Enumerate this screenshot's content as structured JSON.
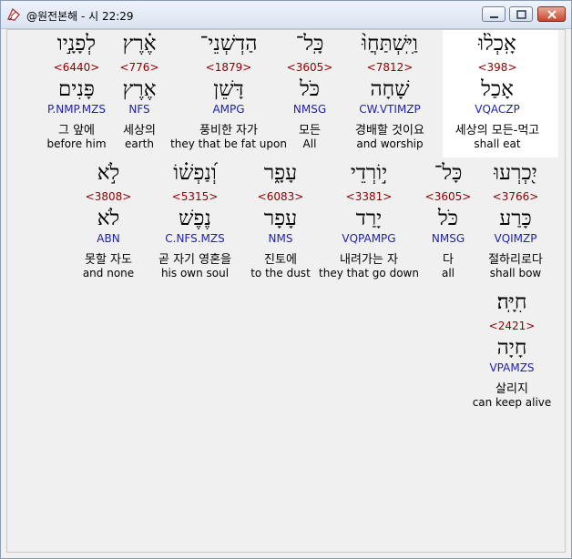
{
  "window": {
    "title": "@원전본해 - 시 22:29"
  },
  "colors": {
    "strongs": "#8b0000",
    "parsing": "#1f1fa8",
    "highlight": "#ffffff"
  },
  "words": [
    {
      "hebrew": "אָֽכְל֨וּ",
      "strongs": "<398>",
      "lemma": "אָכַל",
      "parsing": "VQACZP",
      "korean": "세상의 모든-먹고",
      "english": "shall eat"
    },
    {
      "hebrew": "וַיִּֽשְׁתַּחֲוּ֨",
      "strongs": "<7812>",
      "lemma": "שָׁחָה",
      "parsing": "CW.VTIMZP",
      "korean": "경배할 것이요",
      "english": "and worship"
    },
    {
      "hebrew": "כָּֽל־",
      "strongs": "<3605>",
      "lemma": "כֹּל",
      "parsing": "NMSG",
      "korean": "모든",
      "english": "All"
    },
    {
      "hebrew": "הַדְשְׁנֵי־",
      "strongs": "<1879>",
      "lemma": "דָּשֵׁן",
      "parsing": "AMPG",
      "korean": "풍비한 자가",
      "english": "they that be fat upon"
    },
    {
      "hebrew": "אֶ֗רֶץ",
      "strongs": "<776>",
      "lemma": "אֶרֶץ",
      "parsing": "NFS",
      "korean": "세상의",
      "english": "earth"
    },
    {
      "hebrew": "לְפָנָ֣יו",
      "strongs": "<6440>",
      "lemma": "פָּנִים",
      "parsing": "P.NMP.MZS",
      "korean": "그 앞에",
      "english": "before him"
    },
    {
      "hebrew": "יִ֭כְרְעוּ",
      "strongs": "<3766>",
      "lemma": "כָּרַע",
      "parsing": "VQIMZP",
      "korean": "절하리로다",
      "english": "shall bow"
    },
    {
      "hebrew": "כָּל־",
      "strongs": "<3605>",
      "lemma": "כֹּל",
      "parsing": "NMSG",
      "korean": "다",
      "english": "all"
    },
    {
      "hebrew": "י֣וֹרְדֵי",
      "strongs": "<3381>",
      "lemma": "יָרַד",
      "parsing": "VQPAMPG",
      "korean": "내려가는 자",
      "english": "they that go down"
    },
    {
      "hebrew": "עָפָ֑ר",
      "strongs": "<6083>",
      "lemma": "עָפָר",
      "parsing": "NMS",
      "korean": "진토에",
      "english": "to the dust"
    },
    {
      "hebrew": "וְ֝נַפְשׁ֗וֹ",
      "strongs": "<5315>",
      "lemma": "נֶפֶשׁ",
      "parsing": "C.NFS.MZS",
      "korean": "곧 자기 영혼을",
      "english": "his own soul"
    },
    {
      "hebrew": "לֹ֣א",
      "strongs": "<3808>",
      "lemma": "לֹא",
      "parsing": "ABN",
      "korean": "못할 자도",
      "english": "and none"
    },
    {
      "hebrew": "חִיָּֽה׃",
      "strongs": "<2421>",
      "lemma": "חָיָה",
      "parsing": "VPAMZS",
      "korean": "살리지",
      "english": "can keep alive"
    }
  ]
}
